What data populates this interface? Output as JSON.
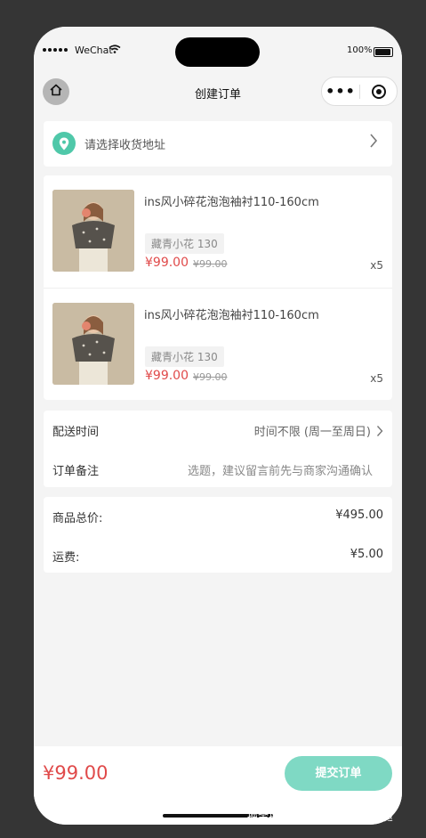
{
  "statusbar": {
    "carrier": "WeChat",
    "battery": "100%"
  },
  "navbar": {
    "title": "创建订单"
  },
  "address": {
    "placeholder": "请选择收货地址"
  },
  "products": [
    {
      "title": "ins风小碎花泡泡袖衬110-160cm",
      "spec": "藏青小花 130",
      "price": "¥99.00",
      "original_price": "¥99.00",
      "quantity": "x5"
    },
    {
      "title": "ins风小碎花泡泡袖衬110-160cm",
      "spec": "藏青小花 130",
      "price": "¥99.00",
      "original_price": "¥99.00",
      "quantity": "x5"
    }
  ],
  "delivery": {
    "label": "配送时间",
    "value": "时间不限 (周一至周日)"
  },
  "remark": {
    "label": "订单备注",
    "value": "选题，建议留言前先与商家沟通确认"
  },
  "summary": {
    "goods_total_label": "商品总价:",
    "goods_total_value": "¥495.00",
    "shipping_label": "运费:",
    "shipping_value": "¥5.00"
  },
  "bottom": {
    "total": "¥99.00",
    "submit_label": "提交订单"
  },
  "watermark": "掘金技术社区 @ 爱泡脚的鸡腿",
  "colors": {
    "accent": "#4fc8a9",
    "submit_button": "#7fd9c4",
    "price_red": "#e04a4a",
    "page_background": "#f4f4f4"
  },
  "icons": [
    "home-icon",
    "more-dots-icon",
    "target-icon",
    "location-pin-icon",
    "chevron-right-icon"
  ]
}
